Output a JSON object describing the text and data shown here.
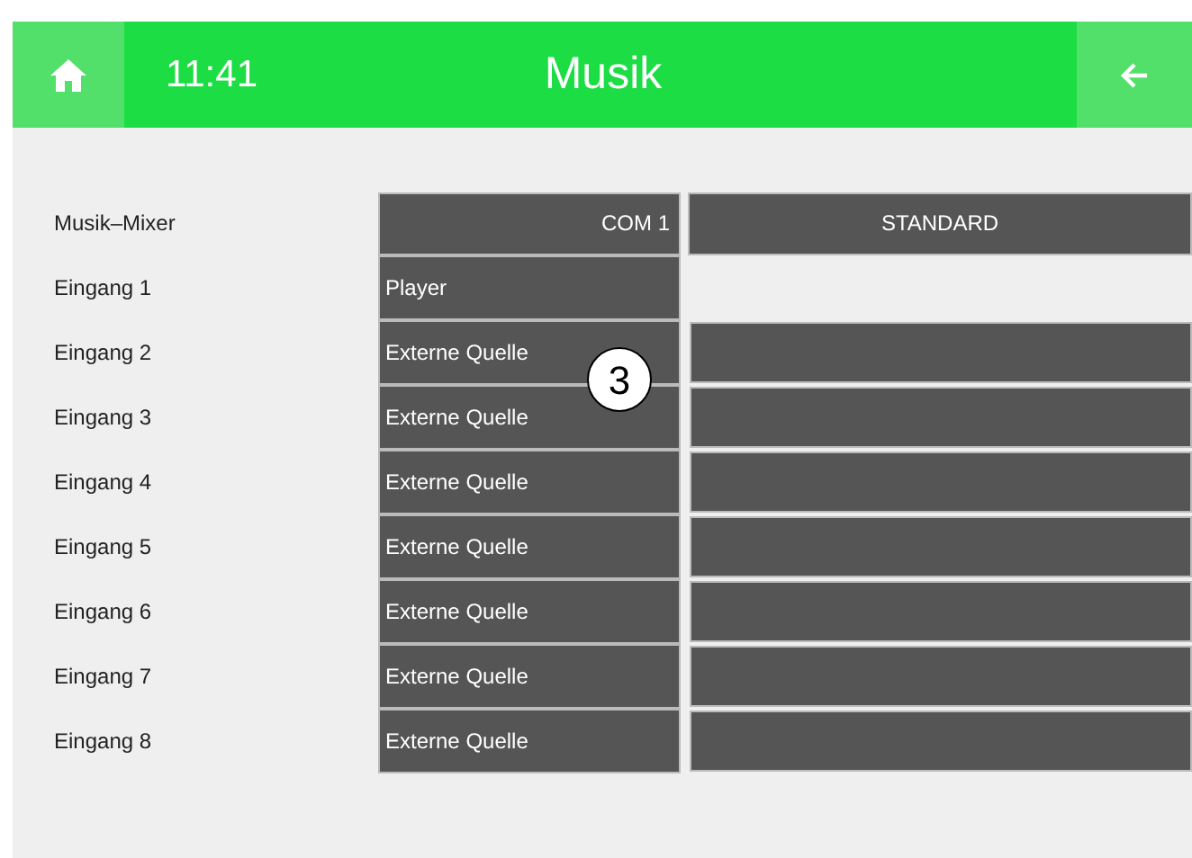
{
  "header": {
    "time": "11:41",
    "title": "Musik"
  },
  "mixer": {
    "label": "Musik–Mixer",
    "column_1": "COM 1",
    "column_2": "STANDARD"
  },
  "rows": [
    {
      "label": "Eingang 1",
      "source": "Player",
      "standard_cell": false
    },
    {
      "label": "Eingang 2",
      "source": "Externe Quelle",
      "standard_cell": true
    },
    {
      "label": "Eingang 3",
      "source": "Externe Quelle",
      "standard_cell": true
    },
    {
      "label": "Eingang 4",
      "source": "Externe Quelle",
      "standard_cell": true
    },
    {
      "label": "Eingang 5",
      "source": "Externe Quelle",
      "standard_cell": true
    },
    {
      "label": "Eingang 6",
      "source": "Externe Quelle",
      "standard_cell": true
    },
    {
      "label": "Eingang 7",
      "source": "Externe Quelle",
      "standard_cell": true
    },
    {
      "label": "Eingang 8",
      "source": "Externe Quelle",
      "standard_cell": true
    }
  ],
  "callout": "3"
}
